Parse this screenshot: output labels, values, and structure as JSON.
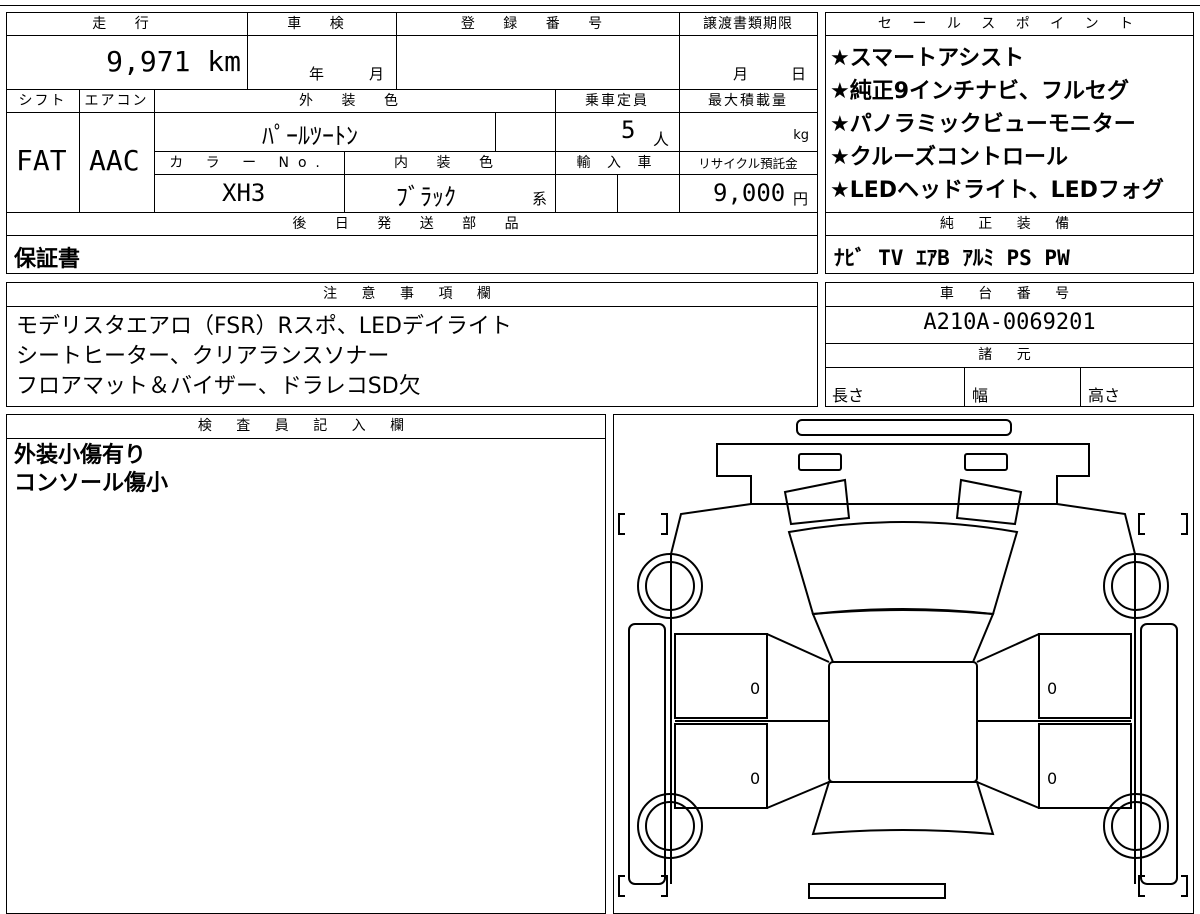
{
  "headers": {
    "mileage": "走 行",
    "inspection": "車 検",
    "registration": "登 録 番 号",
    "transfer_deadline": "譲渡書類期限",
    "sales_points": "セ ー ル ス ポ イ ン ト",
    "shift": "シフト",
    "aircon": "エアコン",
    "exterior_color": "外 装 色",
    "capacity": "乗車定員",
    "max_load": "最大積載量",
    "color_no": "カ ラ ー No.",
    "interior_color": "内 装 色",
    "import": "輸 入 車",
    "recycle": "リサイクル預託金",
    "later_parts": "後 日 発 送 部 品",
    "genuine_equipment": "純 正 装 備",
    "notes": "注 意 事 項 欄",
    "chassis_no": "車 台 番 号",
    "specs": "諸 元",
    "inspector": "検 査 員 記 入 欄"
  },
  "values": {
    "mileage": "9,971 km",
    "inspection_year": "年",
    "inspection_month": "月",
    "deadline_month": "月",
    "deadline_day": "日",
    "shift": "FAT",
    "aircon": "AAC",
    "exterior_color": "ﾊﾟｰﾙﾂｰﾄﾝ",
    "capacity": "5",
    "capacity_unit": "人",
    "max_load_unit": "kg",
    "color_no": "XH3",
    "interior_color": "ﾌﾞﾗｯｸ",
    "interior_suffix": "系",
    "recycle": "9,000",
    "recycle_unit": "円",
    "later_parts": "保証書",
    "genuine_equipment": "ﾅﾋﾞ TV ｴｱB ｱﾙﾐ PS PW",
    "chassis_no": "A210A-0069201",
    "length": "長さ",
    "width": "幅",
    "height": "高さ"
  },
  "sales_points": [
    "★スマートアシスト",
    "★純正9インチナビ、フルセグ",
    "★パノラミックビューモニター",
    "★クルーズコントロール",
    "★LEDヘッドライト、LEDフォグ"
  ],
  "notes": [
    "モデリスタエアロ（FSR）Rスポ、LEDデイライト",
    "シートヒーター、クリアランスソナー",
    "フロアマット＆バイザー、ドラレコSD欠"
  ],
  "inspector_notes": [
    "外装小傷有り",
    "コンソール傷小"
  ],
  "diagram": {
    "door_marks": [
      "0",
      "0",
      "0",
      "0"
    ]
  }
}
